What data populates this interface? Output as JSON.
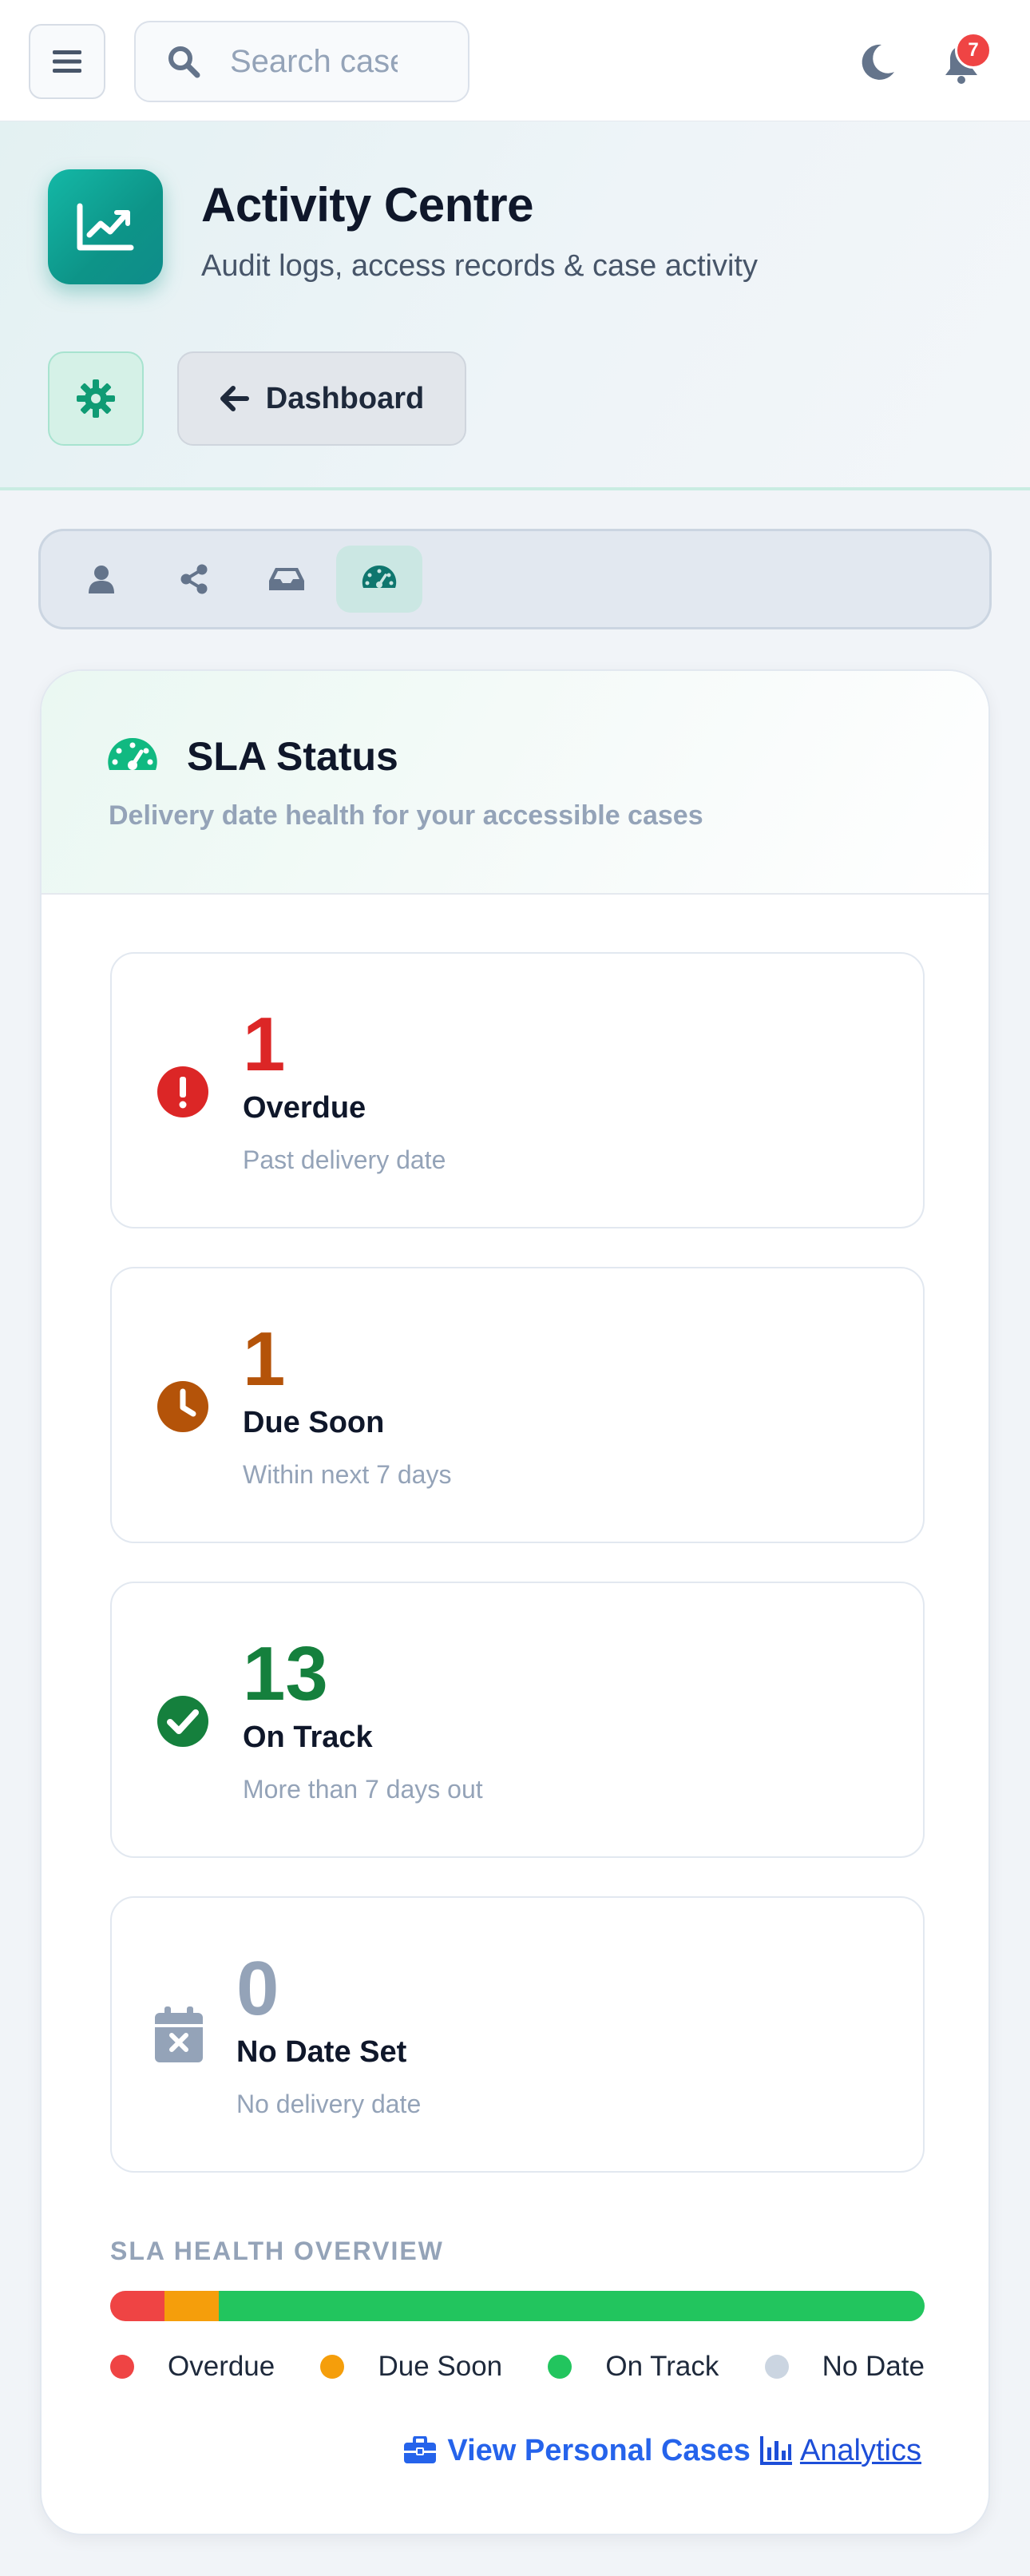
{
  "topbar": {
    "search_placeholder": "Search cases",
    "notification_count": "7"
  },
  "hero": {
    "title": "Activity Centre",
    "subtitle": "Audit logs, access records & case activity",
    "dashboard_button": "Dashboard"
  },
  "tabs": [
    {
      "icon": "user-icon",
      "active": false
    },
    {
      "icon": "share-icon",
      "active": false
    },
    {
      "icon": "inbox-icon",
      "active": false
    },
    {
      "icon": "gauge-icon",
      "active": true
    }
  ],
  "sla": {
    "title": "SLA Status",
    "description": "Delivery date health for your accessible cases",
    "stats": [
      {
        "value": "1",
        "label": "Overdue",
        "sub": "Past delivery date",
        "color": "#dc2626",
        "icon": "exclamation-circle-icon"
      },
      {
        "value": "1",
        "label": "Due Soon",
        "sub": "Within next 7 days",
        "color": "#b45309",
        "icon": "clock-icon"
      },
      {
        "value": "13",
        "label": "On Track",
        "sub": "More than 7 days out",
        "color": "#15803d",
        "icon": "check-circle-icon"
      },
      {
        "value": "0",
        "label": "No Date Set",
        "sub": "No delivery date",
        "color": "#94a3b8",
        "icon": "calendar-x-icon"
      }
    ],
    "health_title": "SLA HEALTH OVERVIEW",
    "health_bar": [
      {
        "name": "Overdue",
        "count": 1,
        "color": "#ef4444"
      },
      {
        "name": "Due Soon",
        "count": 1,
        "color": "#f59e0b"
      },
      {
        "name": "On Track",
        "count": 13,
        "color": "#22c55e"
      },
      {
        "name": "No Date",
        "count": 0,
        "color": "#cbd5e1"
      }
    ],
    "legend": [
      "Overdue",
      "Due Soon",
      "On Track",
      "No Date"
    ],
    "link_personal": "View Personal Cases",
    "link_analytics": "Analytics"
  }
}
